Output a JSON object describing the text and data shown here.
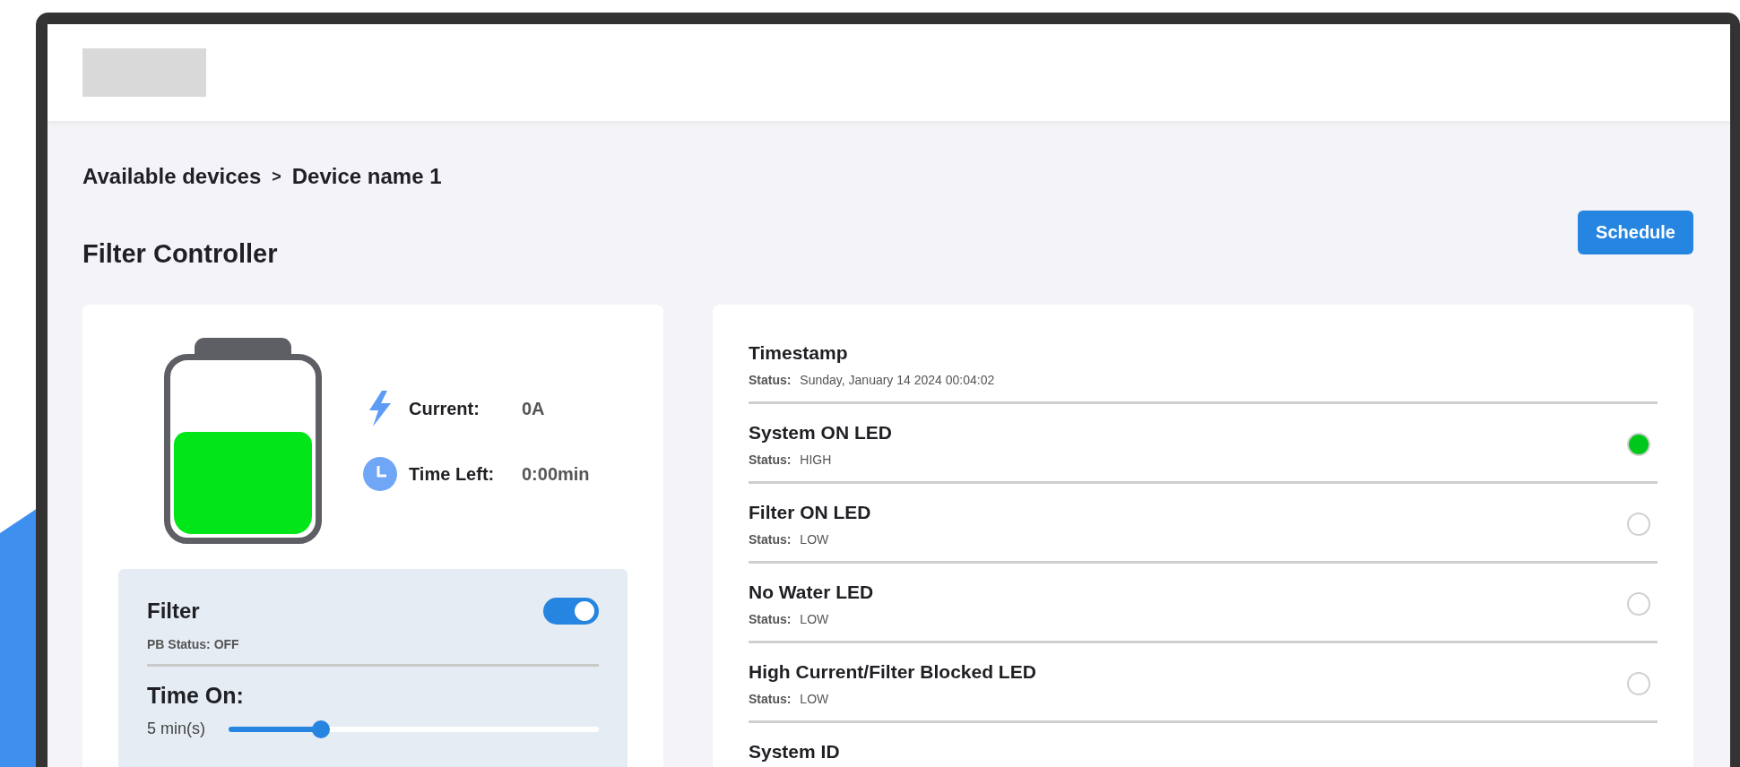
{
  "breadcrumb": {
    "items": [
      "Available devices",
      "Device name 1"
    ],
    "separator": ">"
  },
  "title": "Filter Controller",
  "schedule_button": "Schedule",
  "battery": {
    "level": 0.6
  },
  "readings": [
    {
      "kind": "current",
      "label": "Current:",
      "value": "0A"
    },
    {
      "kind": "time",
      "label": "Time Left:",
      "value": "0:00min"
    }
  ],
  "filter": {
    "title": "Filter",
    "on": true,
    "pb_status": "PB Status: OFF",
    "time_on_label": "Time On:",
    "duration": "5 min(s)",
    "level": 0.25
  },
  "status_rows": [
    {
      "kind": "text",
      "title": "Timestamp",
      "status_label": "Status:",
      "status_value": "Sunday, January 14 2024 00:04:02"
    },
    {
      "kind": "led",
      "title": "System ON LED",
      "status_label": "Status:",
      "status_value": "HIGH",
      "on": true
    },
    {
      "kind": "led",
      "title": "Filter ON LED",
      "status_label": "Status:",
      "status_value": "LOW",
      "on": false
    },
    {
      "kind": "led",
      "title": "No Water LED",
      "status_label": "Status:",
      "status_value": "LOW",
      "on": false
    },
    {
      "kind": "led",
      "title": "High Current/Filter Blocked LED",
      "status_label": "Status:",
      "status_value": "LOW",
      "on": false
    },
    {
      "kind": "text",
      "title": "System ID"
    }
  ]
}
